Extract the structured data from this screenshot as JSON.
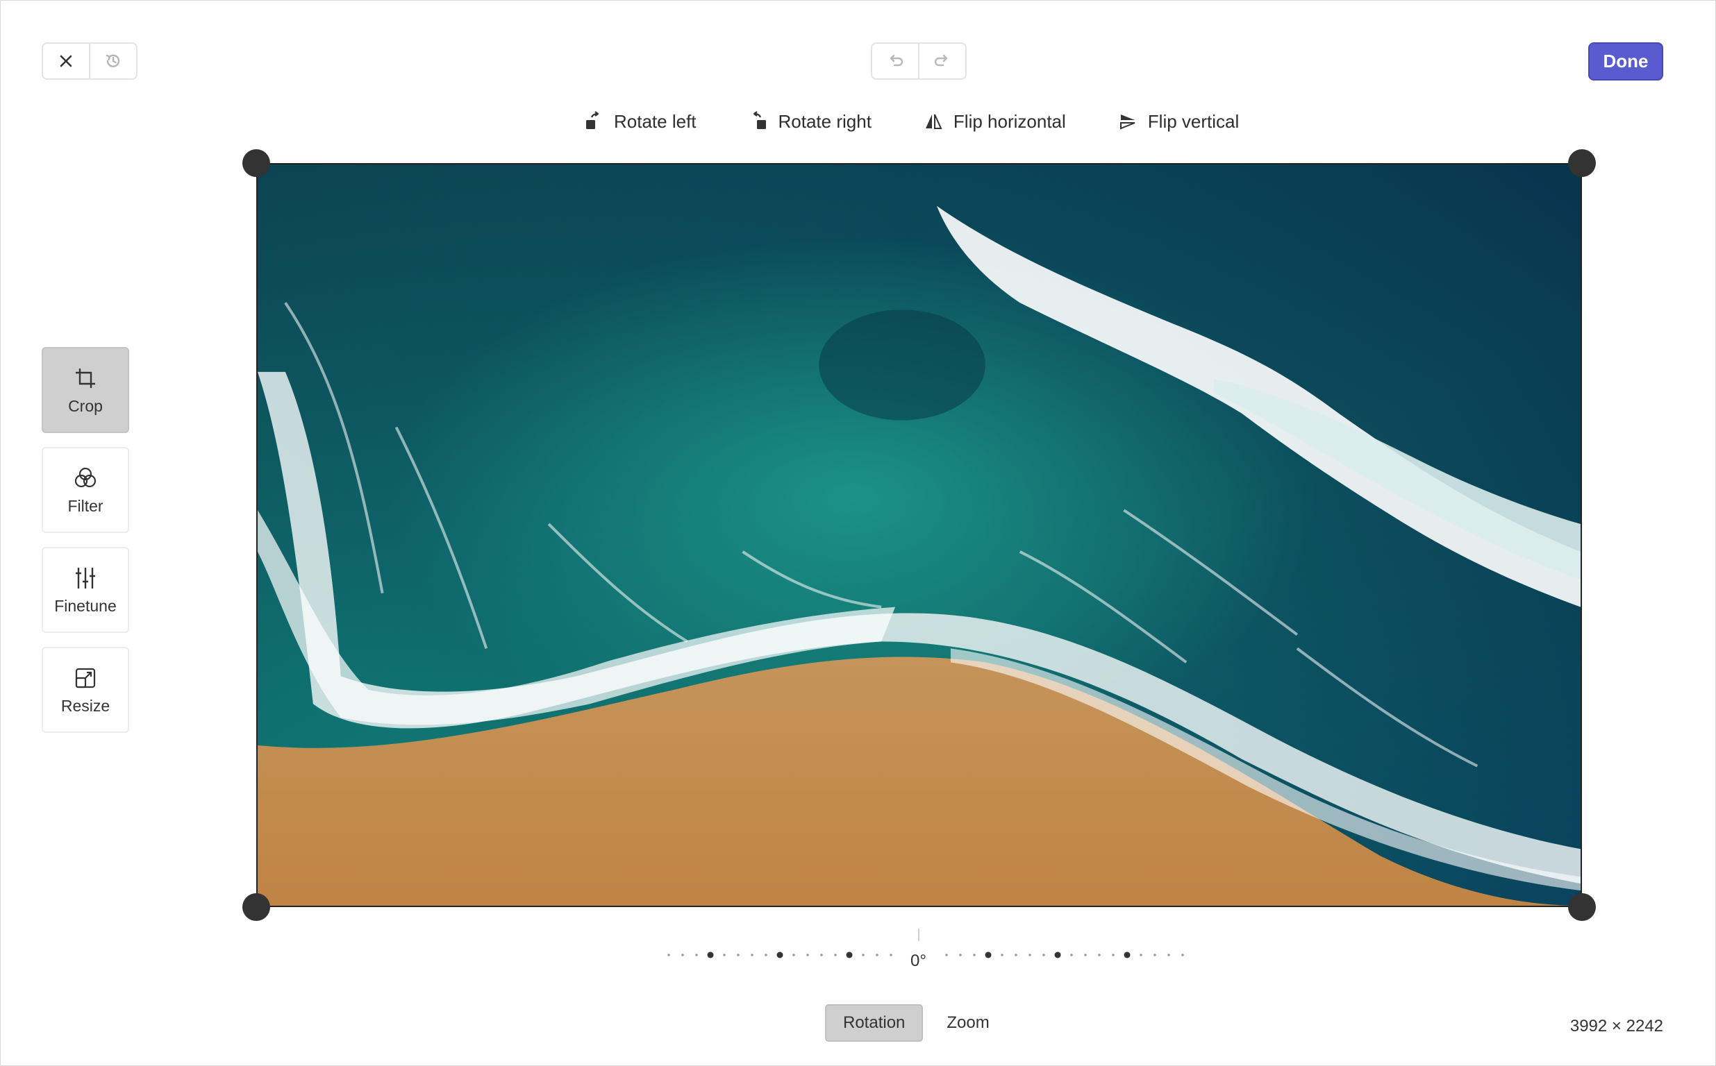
{
  "toolbar": {
    "close_icon": "close-icon",
    "revert_icon": "history-icon",
    "undo_icon": "undo-icon",
    "redo_icon": "redo-icon",
    "done_label": "Done"
  },
  "transform": {
    "rotate_left": "Rotate left",
    "rotate_right": "Rotate right",
    "flip_horizontal": "Flip horizontal",
    "flip_vertical": "Flip vertical"
  },
  "tools": [
    {
      "label": "Crop",
      "icon": "crop-icon",
      "active": true
    },
    {
      "label": "Filter",
      "icon": "filter-icon",
      "active": false
    },
    {
      "label": "Finetune",
      "icon": "sliders-icon",
      "active": false
    },
    {
      "label": "Resize",
      "icon": "resize-icon",
      "active": false
    }
  ],
  "rotation": {
    "value": "0°"
  },
  "modes": {
    "rotation": "Rotation",
    "zoom": "Zoom",
    "active": "Rotation"
  },
  "image": {
    "dimensions": "3992 × 2242"
  },
  "colors": {
    "accent": "#5b5bd0",
    "handle": "#333333"
  }
}
